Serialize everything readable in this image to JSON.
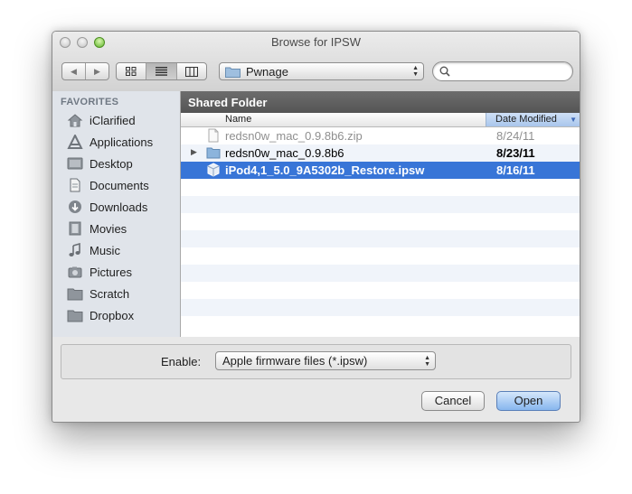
{
  "window": {
    "title": "Browse for IPSW"
  },
  "toolbar": {
    "back_icon": "triangle-left",
    "forward_icon": "triangle-right",
    "views": [
      "icon-view",
      "list-view",
      "column-view"
    ],
    "active_view": "list-view",
    "location": "Pwnage",
    "search_placeholder": ""
  },
  "sidebar": {
    "header": "FAVORITES",
    "items": [
      {
        "label": "iClarified",
        "icon": "house-icon"
      },
      {
        "label": "Applications",
        "icon": "applications-icon"
      },
      {
        "label": "Desktop",
        "icon": "desktop-icon"
      },
      {
        "label": "Documents",
        "icon": "documents-icon"
      },
      {
        "label": "Downloads",
        "icon": "downloads-icon"
      },
      {
        "label": "Movies",
        "icon": "movies-icon"
      },
      {
        "label": "Music",
        "icon": "music-icon"
      },
      {
        "label": "Pictures",
        "icon": "pictures-icon"
      },
      {
        "label": "Scratch",
        "icon": "folder-icon"
      },
      {
        "label": "Dropbox",
        "icon": "folder-icon"
      }
    ]
  },
  "browser": {
    "path_title": "Shared Folder",
    "columns": {
      "name": "Name",
      "date": "Date Modified"
    },
    "sort_indicator": "▼",
    "files": [
      {
        "name": "redsn0w_mac_0.9.8b6.zip",
        "date": "8/24/11",
        "kind": "file",
        "state": "disabled"
      },
      {
        "name": "redsn0w_mac_0.9.8b6",
        "date": "8/23/11",
        "kind": "folder",
        "state": "normal"
      },
      {
        "name": "iPod4,1_5.0_9A5302b_Restore.ipsw",
        "date": "8/16/11",
        "kind": "ipsw",
        "state": "selected"
      }
    ]
  },
  "options": {
    "enable_label": "Enable:",
    "enable_value": "Apple firmware files (*.ipsw)"
  },
  "buttons": {
    "cancel": "Cancel",
    "open": "Open"
  },
  "colors": {
    "selection": "#3875d7",
    "path_bar": "#5e5e5e",
    "sidebar_bg": "#e0e4ea",
    "default_button": "#87b6ee"
  }
}
